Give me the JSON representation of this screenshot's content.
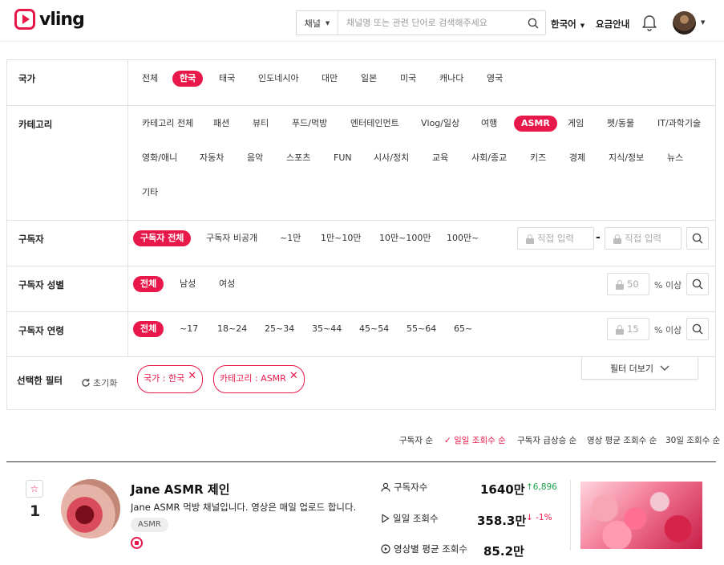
{
  "header": {
    "logo_text": "vling",
    "search": {
      "select_label": "채널",
      "placeholder": "채널명 또는 관련 단어로 검색해주세요"
    },
    "language": "한국어",
    "pricing": "요금안내"
  },
  "filters": {
    "country": {
      "label": "국가",
      "options": [
        "전체",
        "한국",
        "태국",
        "인도네시아",
        "대만",
        "일본",
        "미국",
        "캐나다",
        "영국"
      ],
      "selected": "한국"
    },
    "category": {
      "label": "카테고리",
      "options": [
        "카테고리 전체",
        "패션",
        "뷰티",
        "푸드/먹방",
        "엔터테인먼트",
        "Vlog/일상",
        "여행",
        "ASMR",
        "게임",
        "펫/동물",
        "IT/과학기술",
        "영화/애니",
        "자동차",
        "음악",
        "스포츠",
        "FUN",
        "시사/정치",
        "교육",
        "사회/종교",
        "키즈",
        "경제",
        "지식/정보",
        "뉴스",
        "기타"
      ],
      "selected": "ASMR"
    },
    "subscribers": {
      "label": "구독자",
      "options": [
        "구독자 전체",
        "구독자 비공개",
        "~1만",
        "1만~10만",
        "10만~100만",
        "100만~"
      ],
      "selected": "구독자 전체",
      "min_placeholder": "직접 입력",
      "max_placeholder": "직접 입력",
      "range_separator": "-"
    },
    "gender": {
      "label": "구독자 성별",
      "options": [
        "전체",
        "남성",
        "여성"
      ],
      "selected": "전체",
      "value": "50",
      "suffix": "% 이상"
    },
    "age": {
      "label": "구독자 연령",
      "options": [
        "전체",
        "~17",
        "18~24",
        "25~34",
        "35~44",
        "45~54",
        "55~64",
        "65~"
      ],
      "selected": "전체",
      "value": "15",
      "suffix": "% 이상"
    },
    "selected_filters": {
      "label": "선택한 필터",
      "reset_label": "초기화",
      "tags": [
        "국가 : 한국",
        "카테고리 : ASMR"
      ],
      "more_label": "필터 더보기"
    }
  },
  "sort": {
    "options": [
      "구독자 순",
      "일일 조회수 순",
      "구독자 급상승 순",
      "영상 평균 조회수 순",
      "30일 조회수 순"
    ],
    "selected": "일일 조회수 순"
  },
  "channels": [
    {
      "rank": "1",
      "name": "Jane ASMR 제인",
      "description": "Jane ASMR 먹방 채널입니다. 영상은 매일 업로드 합니다. \\",
      "tag": "ASMR",
      "stats": {
        "subscribers": {
          "label": "구독자수",
          "value": "1640만",
          "change": "↑6,896",
          "trend": "up"
        },
        "daily_views": {
          "label": "일일 조회수",
          "value": "358.3만",
          "change": "↓ -1%",
          "trend": "down"
        },
        "avg_views": {
          "label": "영상별 평균 조회수",
          "value": "85.2만"
        }
      }
    }
  ],
  "colors": {
    "accent": "#e8194a",
    "up": "#1aa34a",
    "down": "#e8194a",
    "border": "#e2e2e2"
  }
}
